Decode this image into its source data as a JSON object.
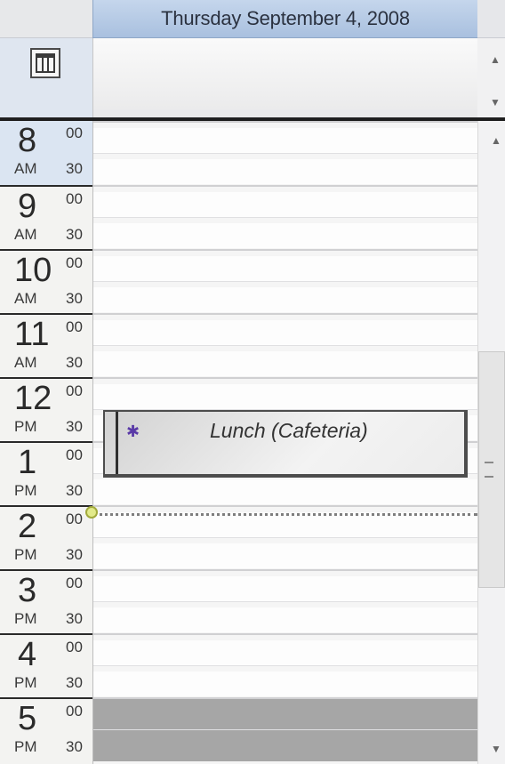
{
  "header": {
    "date": "Thursday September 4, 2008"
  },
  "hours": [
    {
      "h": "8",
      "m00": "00",
      "ampm": "AM",
      "m30": "30"
    },
    {
      "h": "9",
      "m00": "00",
      "ampm": "AM",
      "m30": "30"
    },
    {
      "h": "10",
      "m00": "00",
      "ampm": "AM",
      "m30": "30"
    },
    {
      "h": "11",
      "m00": "00",
      "ampm": "AM",
      "m30": "30"
    },
    {
      "h": "12",
      "m00": "00",
      "ampm": "PM",
      "m30": "30"
    },
    {
      "h": "1",
      "m00": "00",
      "ampm": "PM",
      "m30": "30"
    },
    {
      "h": "2",
      "m00": "00",
      "ampm": "PM",
      "m30": "30"
    },
    {
      "h": "3",
      "m00": "00",
      "ampm": "PM",
      "m30": "30"
    },
    {
      "h": "4",
      "m00": "00",
      "ampm": "PM",
      "m30": "30"
    },
    {
      "h": "5",
      "m00": "00",
      "ampm": "PM",
      "m30": "30"
    }
  ],
  "appointment": {
    "title": "Lunch (Cafeteria)",
    "bullet": "✱"
  },
  "icons": {
    "all_day_button": "calendar-day-view-icon",
    "scroll_up": "▲",
    "scroll_down": "▼",
    "now_marker": "current-time-marker-icon"
  },
  "colors": {
    "header_bg": "#b3c8e5",
    "accent_line": "#1f1f1f",
    "appointment_bullet": "#5a3aa7",
    "off_hours": "#a6a6a6"
  }
}
